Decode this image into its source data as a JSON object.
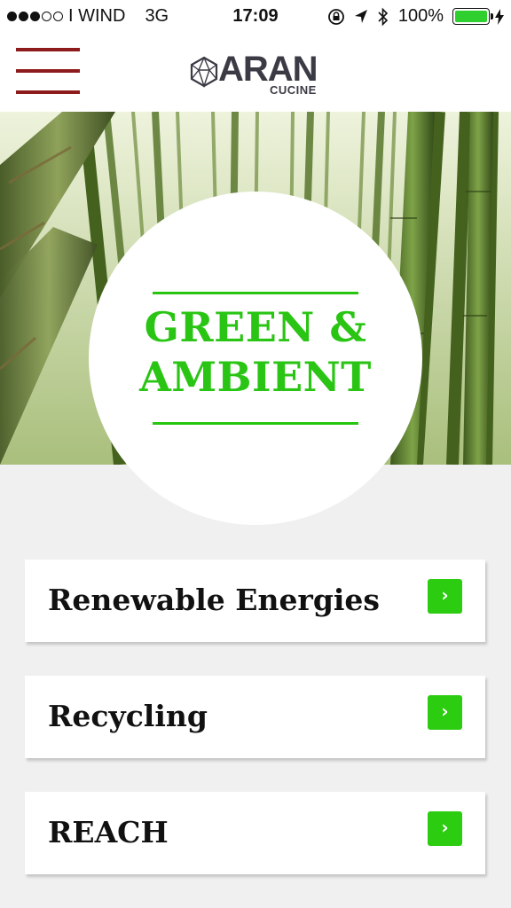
{
  "status_bar": {
    "carrier": "I WIND",
    "network": "3G",
    "time": "17:09",
    "battery_percent": "100%",
    "battery_level": 1.0,
    "signal_bars_filled": 3,
    "signal_bars_total": 5,
    "icons": [
      "rotation-lock-icon",
      "location-arrow-icon",
      "bluetooth-icon",
      "battery-icon",
      "charging-bolt-icon"
    ]
  },
  "header": {
    "logo_word": "ARAN",
    "logo_sub": "CUCINE",
    "menu_icon": "hamburger-menu-icon",
    "menu_color": "#8e1b1b"
  },
  "hero": {
    "title_line1": "GREEN &",
    "title_line2": "AMBIENT",
    "accent_color": "#2ac514"
  },
  "cards": [
    {
      "label": "Renewable Energies",
      "arrow": "›"
    },
    {
      "label": "Recycling",
      "arrow": "›"
    },
    {
      "label": "REACH",
      "arrow": "›"
    }
  ]
}
